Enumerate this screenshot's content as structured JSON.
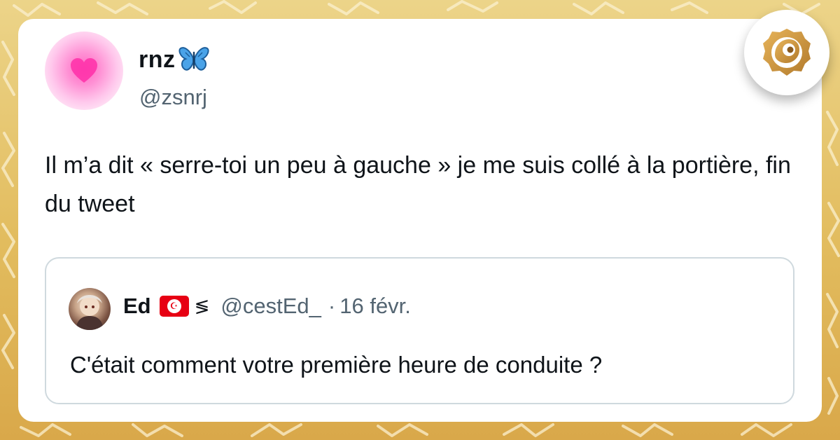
{
  "tweet": {
    "author_name": "rnz",
    "author_emoji": "butterfly-icon",
    "author_handle": "@zsnrj",
    "text": "Il m’a dit « serre-toi un peu à gauche » je me suis collé à la portière, fin du tweet"
  },
  "quoted_tweet": {
    "author_name": "Ed",
    "author_flag": "tunisia-flag-icon",
    "author_handle": "@cestEd_",
    "separator": "·",
    "date": "16 févr.",
    "text": "C'était comment votre première heure de conduite ?"
  },
  "colors": {
    "background": "#e2bc5e",
    "card": "#ffffff",
    "text_primary": "#0f1419",
    "text_secondary": "#536471",
    "quote_border": "#cfd9de",
    "logo_gold": "#c9913a"
  }
}
